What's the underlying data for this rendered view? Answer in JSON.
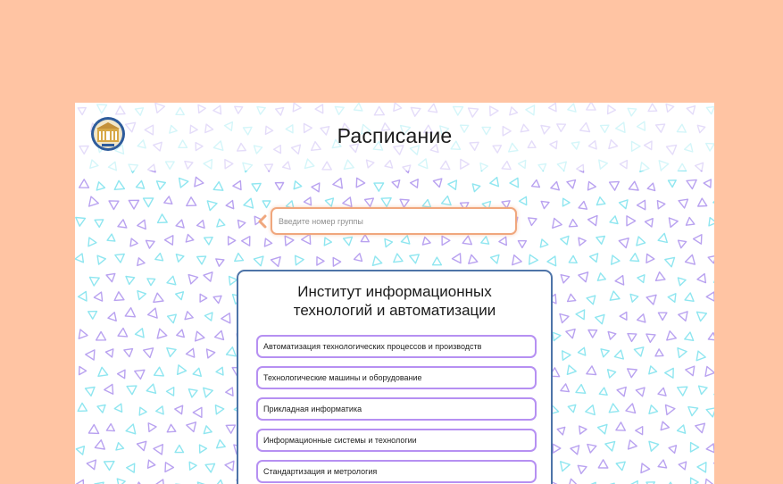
{
  "header": {
    "title": "Расписание",
    "logo_icon": "university-emblem-icon"
  },
  "search": {
    "placeholder": "Введите номер группы",
    "value": "",
    "back_icon": "chevron-left-icon"
  },
  "institute": {
    "title_line1": "Институт информационных",
    "title_line2": "технологий и автоматизации",
    "directions": [
      {
        "label": "Автоматизация технологических процессов и производств"
      },
      {
        "label": "Технологические машины и оборудование"
      },
      {
        "label": "Прикладная информатика"
      },
      {
        "label": "Информационные системы и технологии"
      },
      {
        "label": "Стандартизация и метрология"
      }
    ]
  },
  "colors": {
    "page_background": "#FFC4A3",
    "search_border": "#F0A77D",
    "card_border": "#4E74A8",
    "item_border": "#B690F2",
    "pattern_colors": [
      "#B9A2F0",
      "#8FE6F0"
    ]
  }
}
